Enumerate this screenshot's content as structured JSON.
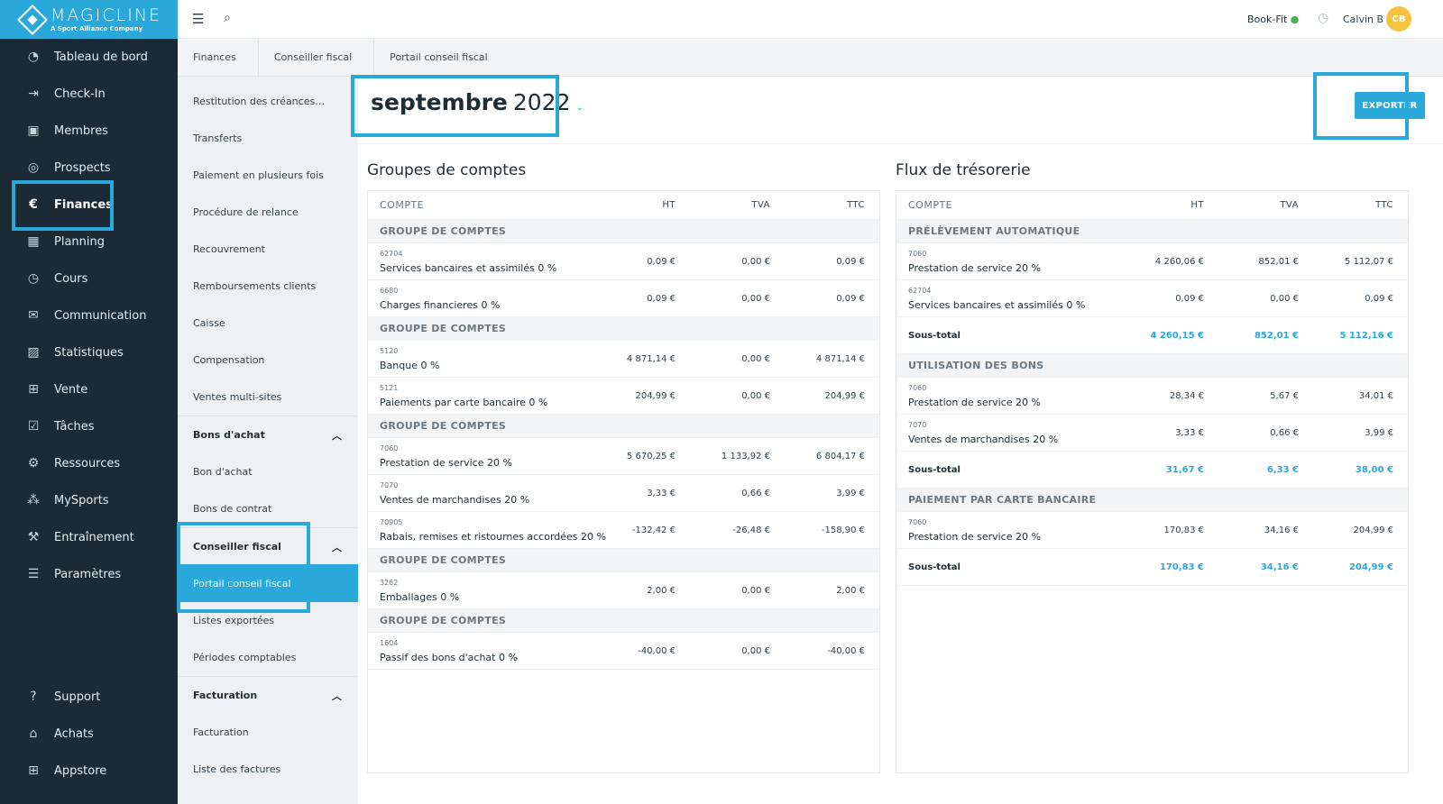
{
  "brand": {
    "name": "MAGICLINE",
    "sub": "A Sport Alliance Company"
  },
  "nav": {
    "items": [
      {
        "label": "Tableau de bord",
        "icon": "dashboard-icon",
        "glyph": "◔"
      },
      {
        "label": "Check-In",
        "icon": "check-in-icon",
        "glyph": "⇥"
      },
      {
        "label": "Membres",
        "icon": "members-icon",
        "glyph": "▣"
      },
      {
        "label": "Prospects",
        "icon": "prospects-icon",
        "glyph": "◎"
      },
      {
        "label": "Finances",
        "icon": "finances-icon",
        "glyph": "€"
      },
      {
        "label": "Planning",
        "icon": "planning-icon",
        "glyph": "▦"
      },
      {
        "label": "Cours",
        "icon": "courses-icon",
        "glyph": "◷"
      },
      {
        "label": "Communication",
        "icon": "communication-icon",
        "glyph": "✉"
      },
      {
        "label": "Statistiques",
        "icon": "statistics-icon",
        "glyph": "▨"
      },
      {
        "label": "Vente",
        "icon": "cart-icon",
        "glyph": "⊞"
      },
      {
        "label": "Tâches",
        "icon": "tasks-icon",
        "glyph": "☑"
      },
      {
        "label": "Ressources",
        "icon": "resources-icon",
        "glyph": "⚙"
      },
      {
        "label": "MySports",
        "icon": "mysports-icon",
        "glyph": "⁂"
      },
      {
        "label": "Entraînement",
        "icon": "training-icon",
        "glyph": "⚒"
      },
      {
        "label": "Paramètres",
        "icon": "settings-icon",
        "glyph": "☰"
      }
    ],
    "bottom": [
      {
        "label": "Support",
        "icon": "support-icon",
        "glyph": "?"
      },
      {
        "label": "Achats",
        "icon": "purchases-icon",
        "glyph": "⌂"
      },
      {
        "label": "Appstore",
        "icon": "appstore-icon",
        "glyph": "⊞"
      }
    ]
  },
  "topbar": {
    "studio": "Book-Fit",
    "user": "Calvin B",
    "initials": "CB"
  },
  "breadcrumbs": [
    "Finances",
    "Conseiller fiscal",
    "Portail conseil fiscal"
  ],
  "subnav": {
    "items": [
      "Restitution des créances…",
      "Transferts",
      "Paiement en plusieurs fois",
      "Procédure de relance",
      "Recouvrement",
      "Remboursements clients",
      "Caisse",
      "Compensation",
      "Ventes multi-sites"
    ],
    "bons_head": "Bons d'achat",
    "bons": [
      "Bon d'achat",
      "Bons de contrat"
    ],
    "fiscal_head": "Conseiller fiscal",
    "fiscal": [
      "Portail conseil fiscal",
      "Listes exportées",
      "Périodes comptables"
    ],
    "fact_head": "Facturation",
    "fact": [
      "Facturation",
      "Liste des factures"
    ]
  },
  "period": {
    "month": "septembre",
    "year": "2022"
  },
  "export_label": "EXPORTER",
  "left": {
    "title": "Groupes de comptes",
    "cols": [
      "COMPTE",
      "HT",
      "TVA",
      "TTC"
    ],
    "group_label": "GROUPE DE COMPTES",
    "rows": [
      {
        "code": "62704",
        "label": "Services bancaires et assimilés 0 %",
        "ht": "0,09 €",
        "tva": "0,00 €",
        "ttc": "0,09 €"
      },
      {
        "code": "6680",
        "label": "Charges financieres 0 %",
        "ht": "0,09 €",
        "tva": "0,00 €",
        "ttc": "0,09 €"
      },
      {
        "code": "5120",
        "label": "Banque 0 %",
        "ht": "4 871,14 €",
        "tva": "0,00 €",
        "ttc": "4 871,14 €"
      },
      {
        "code": "5121",
        "label": "Paiements par carte bancaire 0 %",
        "ht": "204,99 €",
        "tva": "0,00 €",
        "ttc": "204,99 €"
      },
      {
        "code": "7060",
        "label": "Prestation de service 20 %",
        "ht": "5 670,25 €",
        "tva": "1 133,92 €",
        "ttc": "6 804,17 €"
      },
      {
        "code": "7070",
        "label": "Ventes de marchandises 20 %",
        "ht": "3,33 €",
        "tva": "0,66 €",
        "ttc": "3,99 €"
      },
      {
        "code": "70905",
        "label": "Rabais, remises et ristournes accordées 20 %",
        "ht": "-132,42 €",
        "tva": "-26,48 €",
        "ttc": "-158,90 €"
      },
      {
        "code": "3262",
        "label": "Emballages 0 %",
        "ht": "2,00 €",
        "tva": "0,00 €",
        "ttc": "2,00 €"
      },
      {
        "code": "1604",
        "label": "Passif des bons d'achat 0 %",
        "ht": "-40,00 €",
        "tva": "0,00 €",
        "ttc": "-40,00 €"
      }
    ]
  },
  "right": {
    "title": "Flux de trésorerie",
    "cols": [
      "COMPTE",
      "HT",
      "TVA",
      "TTC"
    ],
    "groups": [
      "PRÉLÈVEMENT AUTOMATIQUE",
      "UTILISATION DES BONS",
      "PAIEMENT PAR CARTE BANCAIRE"
    ],
    "subtotal_label": "Sous-total",
    "rows": [
      {
        "code": "7060",
        "label": "Prestation de service 20 %",
        "ht": "4 260,06 €",
        "tva": "852,01 €",
        "ttc": "5 112,07 €"
      },
      {
        "code": "62704",
        "label": "Services bancaires et assimilés 0 %",
        "ht": "0,09 €",
        "tva": "0,00 €",
        "ttc": "0,09 €"
      },
      {
        "code": "7060",
        "label": "Prestation de service 20 %",
        "ht": "28,34 €",
        "tva": "5,67 €",
        "ttc": "34,01 €"
      },
      {
        "code": "7070",
        "label": "Ventes de marchandises 20 %",
        "ht": "3,33 €",
        "tva": "0,66 €",
        "ttc": "3,99 €"
      },
      {
        "code": "7060",
        "label": "Prestation de service 20 %",
        "ht": "170,83 €",
        "tva": "34,16 €",
        "ttc": "204,99 €"
      }
    ],
    "subtotals": [
      {
        "ht": "4 260,15 €",
        "tva": "852,01 €",
        "ttc": "5 112,16 €"
      },
      {
        "ht": "31,67 €",
        "tva": "6,33 €",
        "ttc": "38,00 €"
      },
      {
        "ht": "170,83 €",
        "tva": "34,16 €",
        "ttc": "204,99 €"
      }
    ]
  },
  "colors": {
    "accent": "#2aa8da",
    "nav_bg": "#1b2a35"
  }
}
